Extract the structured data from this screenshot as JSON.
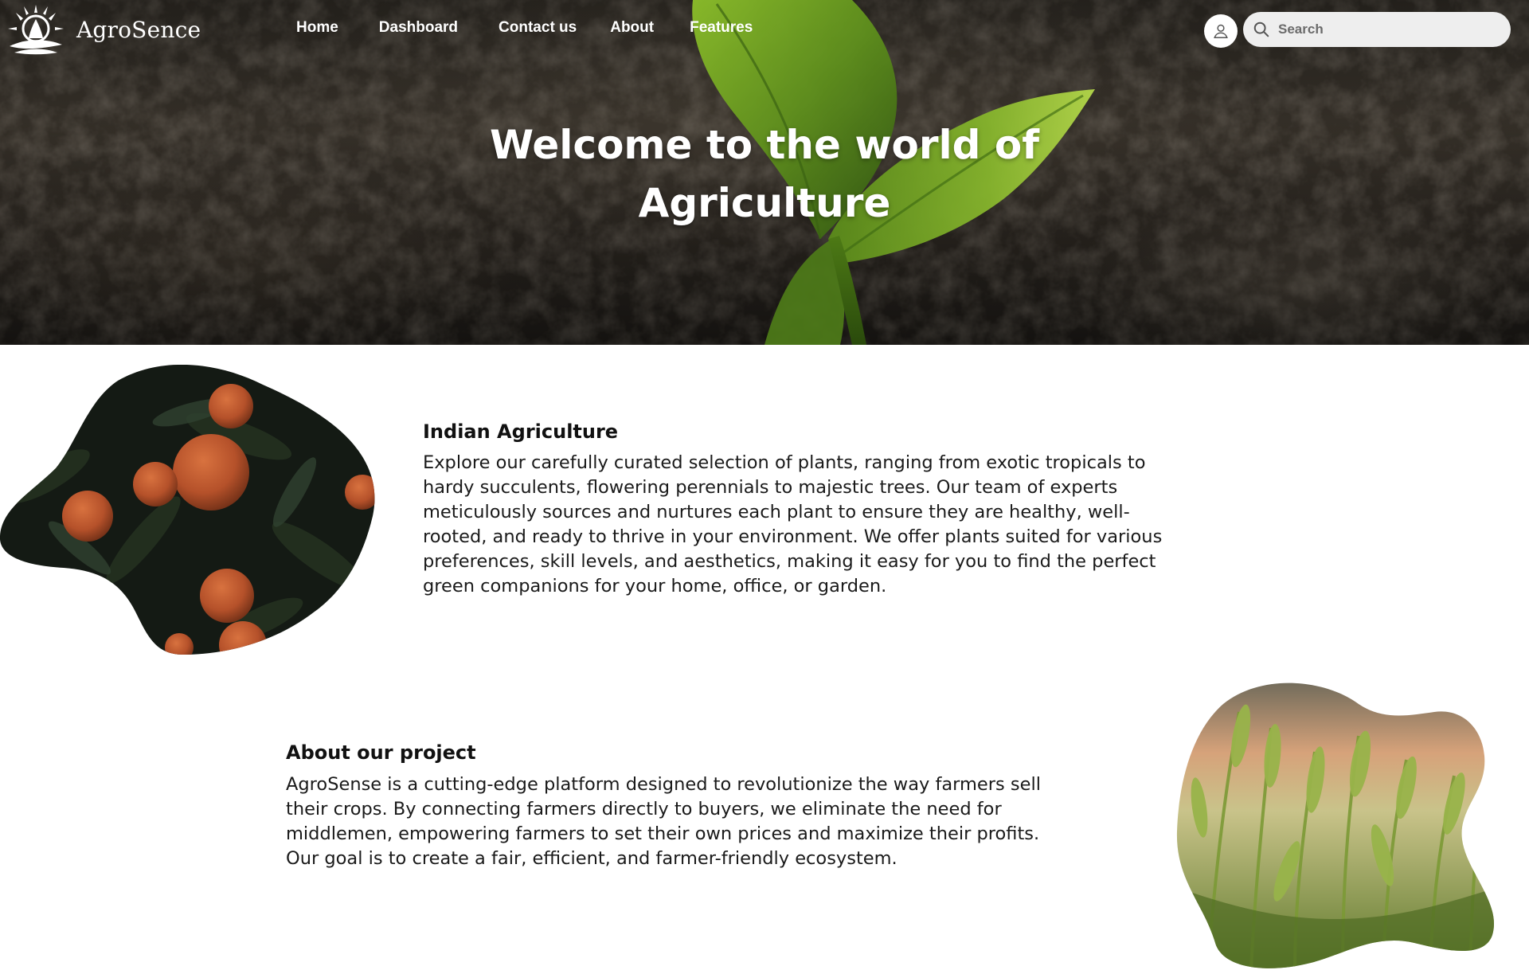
{
  "brand": {
    "name": "AgroSence"
  },
  "nav": {
    "links": [
      {
        "label": "Home"
      },
      {
        "label": "Dashboard"
      },
      {
        "label": "Contact us"
      },
      {
        "label": "About"
      },
      {
        "label": "Features"
      }
    ]
  },
  "search": {
    "placeholder": "Search",
    "value": ""
  },
  "hero": {
    "title_line1": "Welcome to the world of",
    "title_line2": "Agriculture"
  },
  "sections": [
    {
      "title": "Indian Agriculture",
      "text": "Explore our carefully curated selection of plants, ranging from exotic tropicals to hardy succulents, flowering perennials to majestic trees. Our team of experts meticulously sources and nurtures each plant to ensure they are healthy, well-rooted, and ready to thrive in your environment. We offer plants suited for various preferences, skill levels, and aesthetics, making it easy for you to find the perfect green companions for your home, office, or garden.",
      "image": "oranges-photo"
    },
    {
      "title": "About our project",
      "text": "AgroSense is a cutting-edge platform designed to revolutionize the way farmers sell their crops. By connecting farmers directly to buyers, we eliminate the need for middlemen, empowering farmers to set their own prices and maximize their profits. Our goal is to create a fair, efficient, and farmer-friendly ecosystem.",
      "image": "wheat-photo"
    }
  ],
  "icons": {
    "logo": "sun-wheat-logo-icon",
    "avatar": "user-icon",
    "search": "search-icon"
  },
  "colors": {
    "nav_text": "#ffffff",
    "search_bg": "#eeeeee",
    "body_text": "#111111",
    "leaf_green": "#6a9a1e"
  }
}
